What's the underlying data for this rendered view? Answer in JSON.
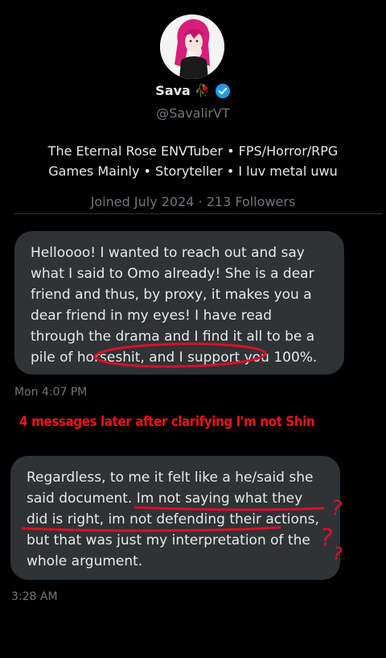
{
  "profile": {
    "name": "Sava",
    "rose_emoji": "🥀",
    "handle": "@SavalirVT",
    "bio_line1": "The Eternal Rose ENVTuber • FPS/Horror/RPG",
    "bio_line2": "Games Mainly • Storyteller • I luv metal uwu",
    "joined": "Joined July 2024 · 213 Followers"
  },
  "messages": [
    {
      "text": "Helloooo! I wanted to reach out and say what I said to Omo already! She is a dear friend and thus, by proxy, it makes you a dear friend in my eyes! I have read through the drama and I find it all to be a pile of horseshit, and I support you 100%.",
      "time": "Mon 4:07 PM"
    },
    {
      "text": "Regardless, to me it felt like a he/said she said document. Im not saying what they did is right, im not defending their actions, but that was just my interpretation of the whole argument.",
      "time": "3:28 AM"
    }
  ],
  "annotation": {
    "caption": "4 messages later after clarifying I'm not Shin",
    "color": "#e8141c"
  },
  "colors": {
    "background": "#000000",
    "bubble": "#2f3336",
    "verified": "#1d9bf0",
    "muted": "#71767b"
  }
}
